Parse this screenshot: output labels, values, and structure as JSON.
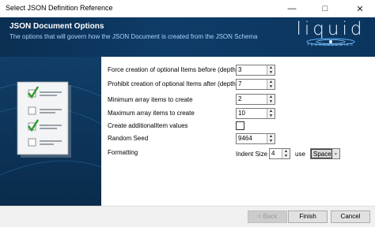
{
  "window": {
    "title": "Select JSON Definition Reference",
    "minimize_icon": "minimize-icon",
    "maximize_icon": "maximize-icon",
    "close_icon": "close-icon"
  },
  "header": {
    "title": "JSON Document Options",
    "subtitle": "The options that will govern how the JSON Document is created from the JSON Schema",
    "logo_word": "liquid",
    "logo_tagline": "TECHNOLOGIES"
  },
  "options": {
    "force_optional_label": "Force creation of optional Items before (depth)",
    "force_optional_value": "3",
    "prohibit_optional_label": "Prohibit creation of optional Items after (depth)",
    "prohibit_optional_value": "7",
    "min_array_label": "Minimum array items to create",
    "min_array_value": "2",
    "max_array_label": "Maximum array items to create",
    "max_array_value": "10",
    "additional_item_label": "Create additionalItem values",
    "additional_item_checked": false,
    "random_seed_label": "Random Seed",
    "random_seed_value": "9464",
    "formatting_label": "Formatting",
    "indent_size_label": "Indent Size",
    "indent_size_value": "4",
    "use_label": "use",
    "indent_char_value": "Space"
  },
  "footer": {
    "back_label": "< Back",
    "finish_label": "Finish",
    "cancel_label": "Cancel"
  },
  "colors": {
    "header_bg": "#0e3c68",
    "subtitle": "#a8d2ff",
    "check_green": "#2e9b2e"
  }
}
